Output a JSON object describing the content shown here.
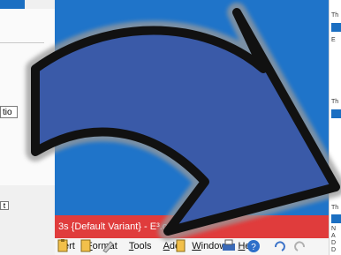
{
  "left_dialog": {
    "field_text": "tio",
    "small_box_text": "t"
  },
  "app": {
    "title": "3s {Default Variant} - E³.cab",
    "menu": [
      {
        "label": "ert",
        "underline": ""
      },
      {
        "label": "Format",
        "underline": "F"
      },
      {
        "label": "Tools",
        "underline": "T"
      },
      {
        "label": "Add",
        "underline": "A"
      },
      {
        "label": "Window",
        "underline": "W"
      },
      {
        "label": "Help",
        "underline": "H"
      }
    ]
  },
  "right_panel": {
    "labels": [
      "Th",
      "E",
      "Th",
      "Th",
      "N",
      "A",
      "D",
      "D"
    ]
  },
  "colors": {
    "desktop_blue": "#1f74c9",
    "arrow_fill": "#3a5aa8",
    "arrow_outline": "#111111",
    "title_red": "#e03c3c"
  }
}
